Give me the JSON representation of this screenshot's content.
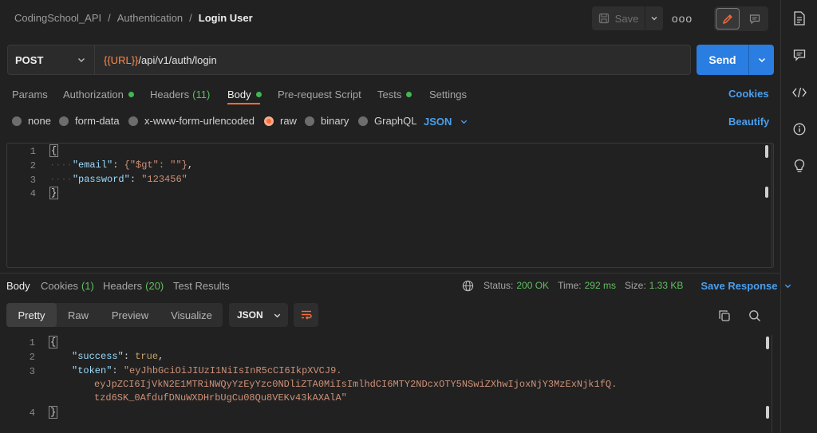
{
  "breadcrumb": [
    "CodingSchool_API",
    "Authentication",
    "Login User"
  ],
  "breadcrumb_sep": "/",
  "toolbar": {
    "save_label": "Save",
    "more_label": "ooo"
  },
  "request": {
    "method": "POST",
    "url_var": "{{URL}}",
    "url_path": "/api/v1/auth/login",
    "send_label": "Send"
  },
  "request_tabs": [
    {
      "label": "Params",
      "count": "",
      "dot": false
    },
    {
      "label": "Authorization",
      "count": "",
      "dot": true
    },
    {
      "label": "Headers",
      "count": "(11)",
      "dot": false
    },
    {
      "label": "Body",
      "count": "",
      "dot": true
    },
    {
      "label": "Pre-request Script",
      "count": "",
      "dot": false
    },
    {
      "label": "Tests",
      "count": "",
      "dot": true
    },
    {
      "label": "Settings",
      "count": "",
      "dot": false
    }
  ],
  "cookies_link": "Cookies",
  "body_types": [
    "none",
    "form-data",
    "x-www-form-urlencoded",
    "raw",
    "binary",
    "GraphQL"
  ],
  "body_type_selected": "raw",
  "body_format": "JSON",
  "beautify_link": "Beautify",
  "request_body": {
    "line_numbers": [
      "1",
      "2",
      "3",
      "4"
    ],
    "open_brace": "{",
    "close_brace": "}",
    "email_key": "\"email\"",
    "email_value": "{\"$gt\": \"\"}",
    "password_key": "\"password\"",
    "password_value": "\"123456\""
  },
  "response_tabs": [
    {
      "label": "Body",
      "count": ""
    },
    {
      "label": "Cookies",
      "count": "(1)"
    },
    {
      "label": "Headers",
      "count": "(20)"
    },
    {
      "label": "Test Results",
      "count": ""
    }
  ],
  "response_meta": {
    "status_label": "Status:",
    "status_value": "200 OK",
    "time_label": "Time:",
    "time_value": "292 ms",
    "size_label": "Size:",
    "size_value": "1.33 KB",
    "save_response": "Save Response"
  },
  "response_views": [
    "Pretty",
    "Raw",
    "Preview",
    "Visualize"
  ],
  "response_view_selected": "Pretty",
  "response_format": "JSON",
  "response_body": {
    "line_numbers": [
      "1",
      "2",
      "3",
      "4"
    ],
    "open_brace": "{",
    "close_brace": "}",
    "success_key": "\"success\"",
    "success_value": "true",
    "token_key": "\"token\"",
    "token_line1": "\"eyJhbGciOiJIUzI1NiIsInR5cCI6IkpXVCJ9.",
    "token_line2": "eyJpZCI6IjVkN2E1MTRiNWQyYzEyYzc0NDliZTA0MiIsImlhdCI6MTY2NDcxOTY5NSwiZXhwIjoxNjY3MzExNjk1fQ.",
    "token_line3": "tzd6SK_0AfdufDNuWXDHrbUgCu08Qu8VEKv43kAXAlA\""
  },
  "colors": {
    "accent": "#ff6c37",
    "send_button": "#2a7de1",
    "link": "#4a9fee",
    "status_ok": "#5fbf5f",
    "json_key": "#9cdcfe",
    "json_string": "#ce9178"
  },
  "icons": [
    "floppy-disk-icon",
    "chevron-down-icon",
    "pencil-icon",
    "comment-icon",
    "document-icon",
    "code-icon",
    "info-icon",
    "lightbulb-icon",
    "globe-icon",
    "copy-icon",
    "search-icon",
    "wrap-lines-icon"
  ]
}
